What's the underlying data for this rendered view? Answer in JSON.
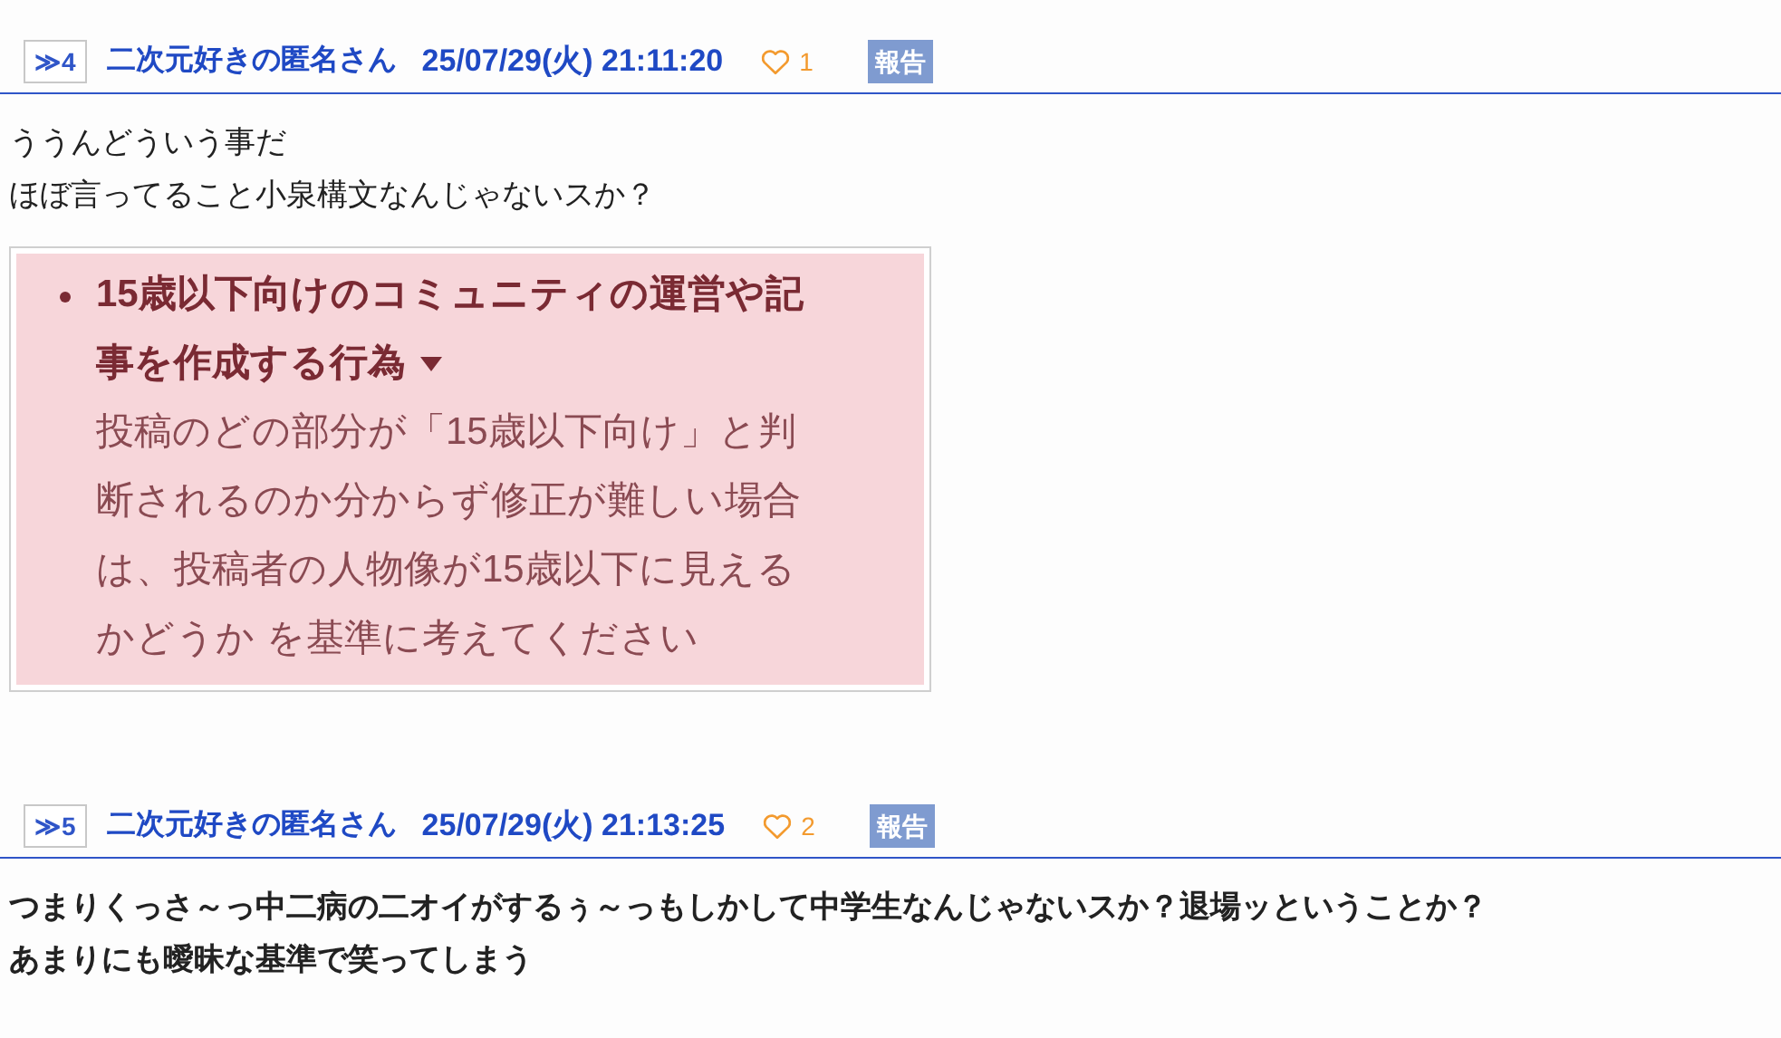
{
  "posts": [
    {
      "number": "≫4",
      "author": "二次元好きの匿名さん",
      "datetime": "25/07/29(火) 21:11:20",
      "likes": "1",
      "report": "報告",
      "bold": false,
      "body": [
        "ううんどういう事だ",
        "ほぼ言ってること小泉構文なんじゃないスか？"
      ],
      "attachment": {
        "title_lines": [
          "15歳以下向けのコミュニティの運営や記",
          "事を作成する行為"
        ],
        "text_lines": [
          "投稿のどの部分が「15歳以下向け」と判",
          "断されるのか分からず修正が難しい場合",
          "は、投稿者の人物像が15歳以下に見える",
          "かどうか を基準に考えてください"
        ]
      }
    },
    {
      "number": "≫5",
      "author": "二次元好きの匿名さん",
      "datetime": "25/07/29(火) 21:13:25",
      "likes": "2",
      "report": "報告",
      "bold": true,
      "body": [
        "つまりくっさ～っ中二病の二オイがするぅ～っもしかして中学生なんじゃないスか？退場ッということか？",
        "あまりにも曖昧な基準で笑ってしまう"
      ]
    }
  ]
}
